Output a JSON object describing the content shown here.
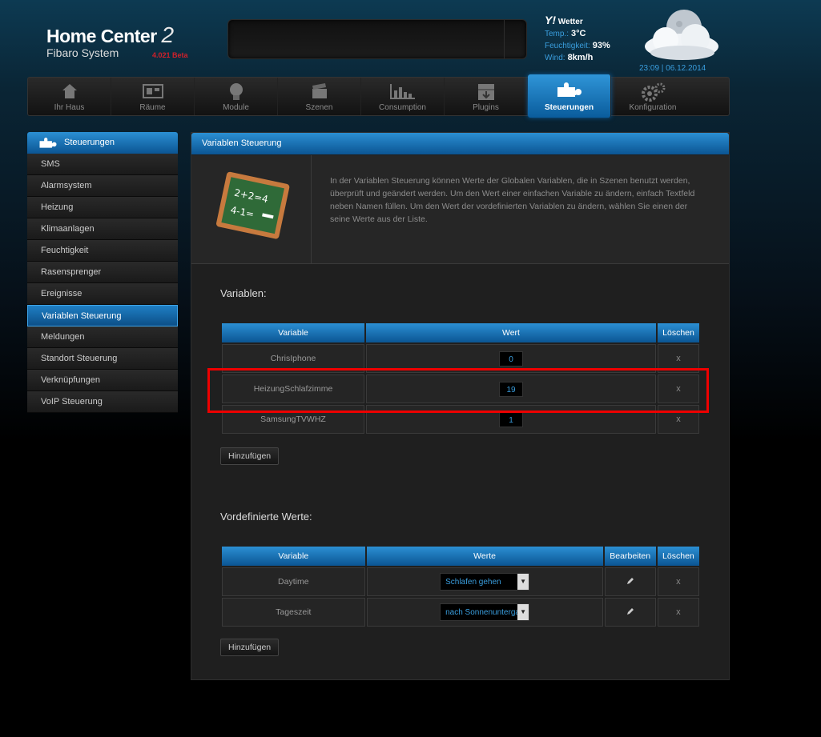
{
  "header": {
    "brand_title": "Home Center",
    "brand_two": "2",
    "brand_sub": "Fibaro System",
    "version": "4.021 Beta"
  },
  "weather": {
    "title": "Wetter",
    "temp_label": "Temp.:",
    "temp_value": "3°C",
    "humidity_label": "Feuchtigkeit:",
    "humidity_value": "93%",
    "wind_label": "Wind:",
    "wind_value": "8km/h",
    "datetime": "23:09 | 06.12.2014"
  },
  "nav": [
    {
      "label": "Ihr Haus",
      "icon": "house-icon"
    },
    {
      "label": "Räume",
      "icon": "rooms-icon"
    },
    {
      "label": "Module",
      "icon": "bulb-icon"
    },
    {
      "label": "Szenen",
      "icon": "clapper-icon"
    },
    {
      "label": "Consumption",
      "icon": "chart-icon"
    },
    {
      "label": "Plugins",
      "icon": "box-icon"
    },
    {
      "label": "Steuerungen",
      "icon": "puzzle-icon",
      "active": true
    },
    {
      "label": "Konfiguration",
      "icon": "gears-icon"
    }
  ],
  "sidebar": {
    "title": "Steuerungen",
    "items": [
      "SMS",
      "Alarmsystem",
      "Heizung",
      "Klimaanlagen",
      "Feuchtigkeit",
      "Rasensprenger",
      "Ereignisse",
      "Variablen Steuerung",
      "Meldungen",
      "Standort Steuerung",
      "Verknüpfungen",
      "VoIP Steuerung"
    ],
    "active_index": 7
  },
  "main": {
    "title": "Variablen Steuerung",
    "intro_text": "In der Variablen Steuerung können Werte der Globalen Variablen, die in Szenen benutzt werden, überprüft und geändert werden. Um den Wert einer einfachen Variable zu ändern, einfach Textfeld neben Namen füllen. Um den Wert der vordefinierten Variablen zu ändern, wählen Sie einen der seine Werte aus der Liste.",
    "board_text_1": "2+2=4",
    "board_text_2": "4-1=",
    "variables": {
      "title": "Variablen:",
      "headers": {
        "variable": "Variable",
        "wert": "Wert",
        "loeschen": "Löschen"
      },
      "rows": [
        {
          "name": "ChrisIphone",
          "value": "0",
          "delete": "x"
        },
        {
          "name": "HeizungSchlafzimme",
          "value": "19",
          "delete": "x"
        },
        {
          "name": "SamsungTVWHZ",
          "value": "1",
          "delete": "x"
        }
      ],
      "add_label": "Hinzufügen"
    },
    "predefined": {
      "title": "Vordefinierte Werte:",
      "headers": {
        "variable": "Variable",
        "werte": "Werte",
        "bearbeiten": "Bearbeiten",
        "loeschen": "Löschen"
      },
      "rows": [
        {
          "name": "Daytime",
          "selected": "Schlafen gehen",
          "delete": "x"
        },
        {
          "name": "Tageszeit",
          "selected": "nach Sonnenuntergang",
          "delete": "x"
        }
      ],
      "add_label": "Hinzufügen"
    }
  },
  "colors": {
    "accent_blue": "#1f7fc4",
    "value_blue": "#3a9ede",
    "highlight_red": "#ee0000",
    "version_red": "#d0202a"
  }
}
